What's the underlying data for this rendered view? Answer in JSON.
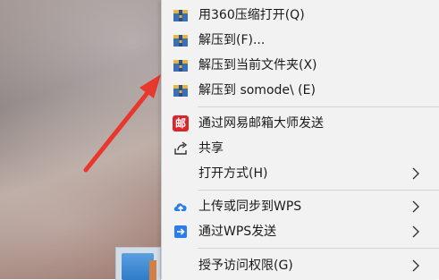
{
  "menu": {
    "items": [
      {
        "label": "用360压缩打开(Q)",
        "icon": "360-archive-icon"
      },
      {
        "label": "解压到(F)...",
        "icon": "360-archive-icon"
      },
      {
        "label": "解压到当前文件夹(X)",
        "icon": "360-archive-icon"
      },
      {
        "label": "解压到 somode\\ (E)",
        "icon": "360-archive-icon"
      },
      {
        "label": "通过网易邮箱大师发送",
        "icon": "netease-mail-master-icon"
      },
      {
        "label": "共享",
        "icon": "share-icon"
      },
      {
        "label": "打开方式(H)",
        "icon": "",
        "submenu": true
      },
      {
        "label": "上传或同步到WPS",
        "icon": "wps-cloud-upload-icon",
        "submenu": true
      },
      {
        "label": "通过WPS发送",
        "icon": "wps-send-icon",
        "submenu": true
      },
      {
        "label": "授予访问权限(G)",
        "icon": "",
        "submenu": true
      }
    ],
    "icon_glyphs": {
      "mail_master": "邮"
    }
  },
  "colors": {
    "menu_bg": "#f2f2f2",
    "arrow": "#e8382e",
    "mail_master_red": "#d9262c",
    "wps_blue": "#2b7de9",
    "archive_blue": "#3a6fb5",
    "archive_yellow": "#e9b53c"
  }
}
